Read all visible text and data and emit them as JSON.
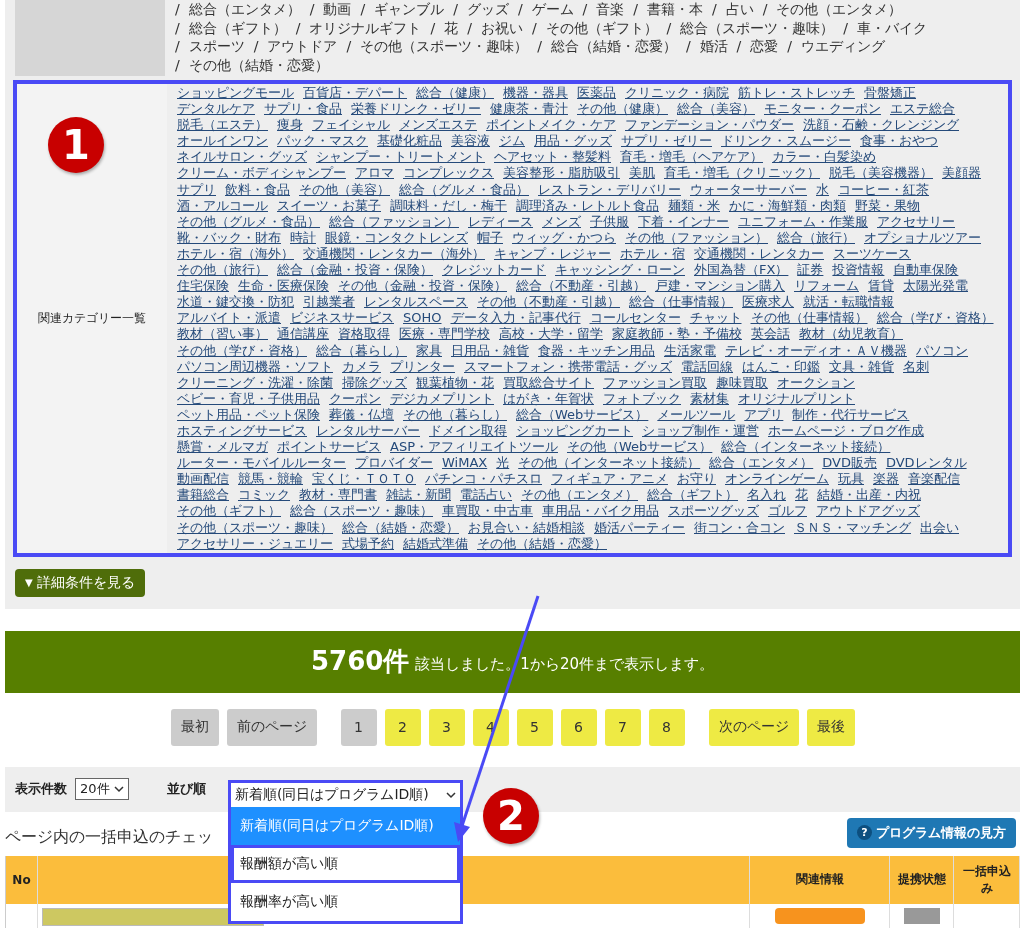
{
  "top_categories": {
    "separator": "/",
    "items": [
      "総合（エンタメ）",
      "動画",
      "ギャンブル",
      "グッズ",
      "ゲーム",
      "音楽",
      "書籍・本",
      "占い",
      "その他（エンタメ）",
      "総合（ギフト）",
      "オリジナルギフト",
      "花",
      "お祝い",
      "その他（ギフト）",
      "総合（スポーツ・趣味）",
      "車・バイク",
      "スポーツ",
      "アウトドア",
      "その他（スポーツ・趣味）",
      "総合（結婚・恋愛）",
      "婚活",
      "恋愛",
      "ウエディング",
      "その他（結婚・恋愛）"
    ]
  },
  "related_categories": {
    "label": "関連カテゴリー一覧",
    "items": [
      "ショッピングモール",
      "百貨店・デパート",
      "総合（健康）",
      "機器・器具",
      "医薬品",
      "クリニック・病院",
      "筋トレ・ストレッチ",
      "骨盤矯正",
      "デンタルケア",
      "サプリ・食品",
      "栄養ドリンク・ゼリー",
      "健康茶・青汁",
      "その他（健康）",
      "総合（美容）",
      "モニター・クーポン",
      "エステ総合",
      "脱毛（エステ）",
      "痩身",
      "フェイシャル",
      "メンズエステ",
      "ポイントメイク・ケア",
      "ファンデーション・パウダー",
      "洗顔・石鹸・クレンジング",
      "オールインワン",
      "パック・マスク",
      "基礎化粧品",
      "美容液",
      "ジム",
      "用品・グッズ",
      "サプリ・ゼリー",
      "ドリンク・スムージー",
      "食事・おやつ",
      "ネイルサロン・グッズ",
      "シャンプー・トリートメント",
      "ヘアセット・整髪料",
      "育毛・増毛（ヘアケア）",
      "カラー・白髪染め",
      "クリーム・ボディシャンプー",
      "アロマ",
      "コンプレックス",
      "美容整形・脂肪吸引",
      "美肌",
      "育毛・増毛（クリニック）",
      "脱毛（美容機器）",
      "美顔器",
      "サプリ",
      "飲料・食品",
      "その他（美容）",
      "総合（グルメ・食品）",
      "レストラン・デリバリー",
      "ウォーターサーバー",
      "水",
      "コーヒー・紅茶",
      "酒・アルコール",
      "スイーツ・お菓子",
      "調味料・だし・梅干",
      "調理済み・レトルト食品",
      "麺類・米",
      "かに・海鮮類・肉類",
      "野菜・果物",
      "その他（グルメ・食品）",
      "総合（ファッション）",
      "レディース",
      "メンズ",
      "子供服",
      "下着・インナー",
      "ユニフォーム・作業服",
      "アクセサリー",
      "靴・バック・財布",
      "時計",
      "眼鏡・コンタクトレンズ",
      "帽子",
      "ウィッグ・かつら",
      "その他（ファッション）",
      "総合（旅行）",
      "オプショナルツアー",
      "ホテル・宿（海外）",
      "交通機関・レンタカー（海外）",
      "キャンプ・レジャー",
      "ホテル・宿",
      "交通機関・レンタカー",
      "スーツケース",
      "その他（旅行）",
      "総合（金融・投資・保険）",
      "クレジットカード",
      "キャッシング・ローン",
      "外国為替（FX）",
      "証券",
      "投資情報",
      "自動車保険",
      "住宅保険",
      "生命・医療保険",
      "その他（金融・投資・保険）",
      "総合（不動産・引越）",
      "戸建・マンション購入",
      "リフォーム",
      "賃貸",
      "太陽光発電",
      "水道・鍵交換・防犯",
      "引越業者",
      "レンタルスペース",
      "その他（不動産・引越）",
      "総合（仕事情報）",
      "医療求人",
      "就活・転職情報",
      "アルバイト・派遣",
      "ビジネスサービス",
      "SOHO",
      "データ入力・記事代行",
      "コールセンター",
      "チャット",
      "その他（仕事情報）",
      "総合（学び・資格）",
      "教材（習い事）",
      "通信講座",
      "資格取得",
      "医療・専門学校",
      "高校・大学・留学",
      "家庭教師・塾・予備校",
      "英会話",
      "教材（幼児教育）",
      "その他（学び・資格）",
      "総合（暮らし）",
      "家具",
      "日用品・雑貨",
      "食器・キッチン用品",
      "生活家電",
      "テレビ・オーディオ・ＡＶ機器",
      "パソコン",
      "パソコン周辺機器・ソフト",
      "カメラ",
      "プリンター",
      "スマートフォン・携帯電話・グッズ",
      "電話回線",
      "はんこ・印鑑",
      "文具・雑貨",
      "名刺",
      "クリーニング・洗濯・除菌",
      "掃除グッズ",
      "観葉植物・花",
      "買取総合サイト",
      "ファッション買取",
      "趣味買取",
      "オークション",
      "ベビー・育児・子供用品",
      "クーポン",
      "デジカメプリント",
      "はがき・年賀状",
      "フォトブック",
      "素材集",
      "オリジナルプリント",
      "ペット用品・ペット保険",
      "葬儀・仏壇",
      "その他（暮らし）",
      "総合（Webサービス）",
      "メールツール",
      "アプリ",
      "制作・代行サービス",
      "ホスティングサービス",
      "レンタルサーバー",
      "ドメイン取得",
      "ショッピングカート",
      "ショップ制作・運営",
      "ホームページ・ブログ作成",
      "懸賞・メルマガ",
      "ポイントサービス",
      "ASP・アフィリエイトツール",
      "その他（Webサービス）",
      "総合（インターネット接続）",
      "ルーター・モバイルルーター",
      "プロバイダー",
      "WiMAX",
      "光",
      "その他（インターネット接続）",
      "総合（エンタメ）",
      "DVD販売",
      "DVDレンタル",
      "動画配信",
      "競馬・競輪",
      "宝くじ・ＴＯＴＯ",
      "パチンコ・パチスロ",
      "フィギュア・アニメ",
      "お守り",
      "オンラインゲーム",
      "玩具",
      "楽器",
      "音楽配信",
      "書籍総合",
      "コミック",
      "教材・専門書",
      "雑誌・新聞",
      "電話占い",
      "その他（エンタメ）",
      "総合（ギフト）",
      "名入れ",
      "花",
      "結婚・出産・内祝",
      "その他（ギフト）",
      "総合（スポーツ・趣味）",
      "車買取・中古車",
      "車用品・バイク用品",
      "スポーツグッズ",
      "ゴルフ",
      "アウトドアグッズ",
      "その他（スポーツ・趣味）",
      "総合（結婚・恋愛）",
      "お見合い・結婚相談",
      "婚活パーティー",
      "街コン・合コン",
      "ＳＮＳ・マッチング",
      "出会い",
      "アクセサリー・ジュエリー",
      "式場予約",
      "結婚式準備",
      "その他（結婚・恋愛）"
    ]
  },
  "details_button": {
    "icon": "▼",
    "label": "詳細条件を見る"
  },
  "result_banner": {
    "count": "5760件",
    "message": "該当しました。1から20件まで表示します。"
  },
  "pagination": {
    "first": {
      "label": "最初",
      "disabled": true
    },
    "prev": {
      "label": "前のページ",
      "disabled": true
    },
    "pages": [
      {
        "label": "1",
        "selected": true
      },
      {
        "label": "2",
        "selected": false
      },
      {
        "label": "3",
        "selected": false
      },
      {
        "label": "4",
        "selected": false
      },
      {
        "label": "5",
        "selected": false
      },
      {
        "label": "6",
        "selected": false
      },
      {
        "label": "7",
        "selected": false
      },
      {
        "label": "8",
        "selected": false
      }
    ],
    "next": {
      "label": "次のページ",
      "disabled": false
    },
    "last": {
      "label": "最後",
      "disabled": false
    }
  },
  "sort_bar": {
    "per_page_label": "表示件数",
    "per_page_value": "20件",
    "sort_label": "並び順",
    "sort_value": "新着順(同日はプログラムID順)",
    "sort_options": [
      {
        "label": "新着順(同日はプログラムID順)",
        "selected": true
      },
      {
        "label": "報酬額が高い順",
        "selected": false
      },
      {
        "label": "報酬率が高い順",
        "selected": false
      }
    ]
  },
  "bulk_text": "ページ内の一括申込のチェッ",
  "help_button": {
    "icon": "?",
    "label": "プログラム情報の見方"
  },
  "table": {
    "columns": [
      "No",
      "関連情報",
      "提携状態",
      "一括申込み"
    ]
  },
  "annotations": [
    {
      "label": "1"
    },
    {
      "label": "2"
    }
  ]
}
